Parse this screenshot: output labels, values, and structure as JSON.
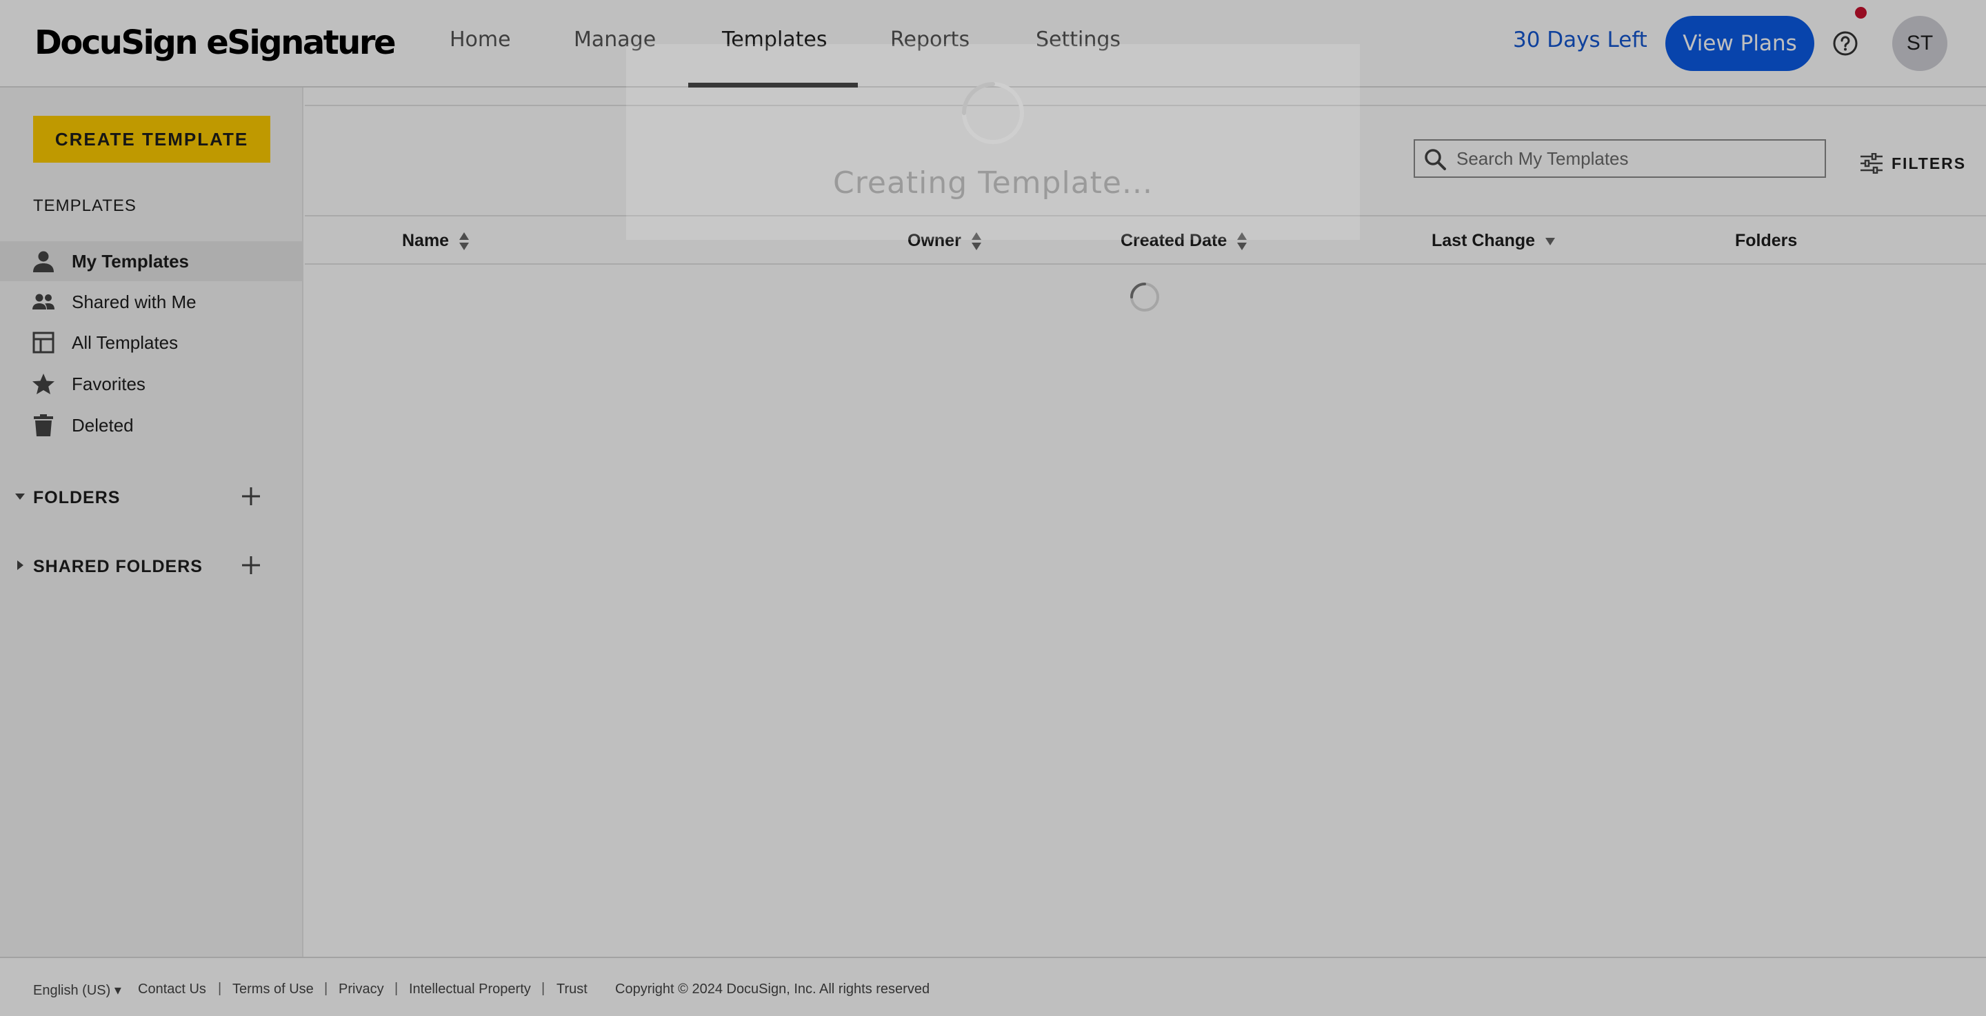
{
  "app": {
    "logo_text": "DocuSign eSignature"
  },
  "nav": {
    "items": [
      {
        "label": "Home"
      },
      {
        "label": "Manage"
      },
      {
        "label": "Templates"
      },
      {
        "label": "Reports"
      },
      {
        "label": "Settings"
      }
    ],
    "active": "Templates"
  },
  "header": {
    "trial_text": "30 Days Left",
    "view_plans_label": "View Plans",
    "avatar_initials": "ST",
    "help_icon": "question-circle-icon",
    "notification_color": "#c8102e"
  },
  "sidebar": {
    "create_label": "CREATE TEMPLATE",
    "heading": "TEMPLATES",
    "items": [
      {
        "label": "My Templates",
        "icon": "person-icon",
        "selected": true
      },
      {
        "label": "Shared with Me",
        "icon": "people-icon",
        "selected": false
      },
      {
        "label": "All Templates",
        "icon": "template-layout-icon",
        "selected": false
      },
      {
        "label": "Favorites",
        "icon": "star-icon",
        "selected": false
      },
      {
        "label": "Deleted",
        "icon": "trash-icon",
        "selected": false
      }
    ],
    "folders_label": "FOLDERS",
    "shared_folders_label": "SHARED FOLDERS"
  },
  "main": {
    "search_placeholder": "Search My Templates",
    "filters_label": "FILTERS",
    "columns": [
      {
        "label": "Name",
        "sort": "both"
      },
      {
        "label": "Owner",
        "sort": "both"
      },
      {
        "label": "Created Date",
        "sort": "both"
      },
      {
        "label": "Last Change",
        "sort": "desc"
      },
      {
        "label": "Folders",
        "sort": "none"
      }
    ]
  },
  "modal": {
    "message": "Creating Template..."
  },
  "footer": {
    "language": "English (US)",
    "links": [
      "Contact Us",
      "Terms of Use",
      "Privacy",
      "Intellectual Property",
      "Trust"
    ],
    "copyright": "Copyright © 2024 DocuSign, Inc. All rights reserved"
  },
  "colors": {
    "accent_blue": "#0b5be6",
    "create_yellow": "#ffcc00"
  }
}
